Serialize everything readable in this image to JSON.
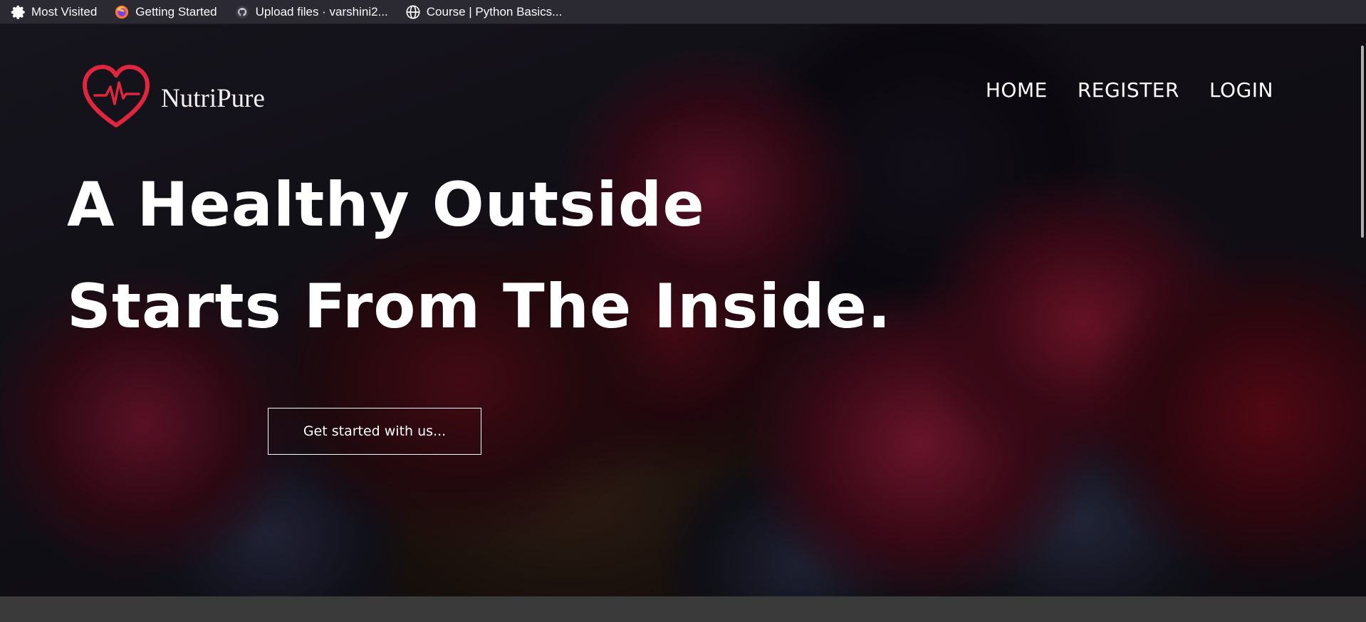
{
  "bookmarks": [
    {
      "label": "Most Visited",
      "icon": "gear-icon"
    },
    {
      "label": "Getting Started",
      "icon": "firefox-icon"
    },
    {
      "label": "Upload files · varshini2...",
      "icon": "github-icon"
    },
    {
      "label": "Course | Python Basics...",
      "icon": "globe-icon"
    }
  ],
  "brand": {
    "name": "NutriPure",
    "logo_color": "#e0263f"
  },
  "nav": {
    "home": "HOME",
    "register": "REGISTER",
    "login": "LOGIN"
  },
  "hero": {
    "line1": "A Healthy Outside",
    "line2": "Starts From The Inside.",
    "cta": "Get started with us..."
  }
}
